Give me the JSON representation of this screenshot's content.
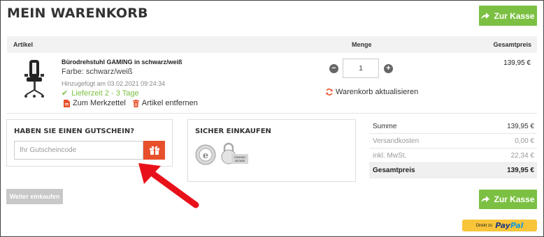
{
  "page": {
    "title": "MEIN WARENKORB"
  },
  "checkout_button_label": "Zur Kasse",
  "table": {
    "col_article": "Artikel",
    "col_quantity": "Menge",
    "col_total": "Gesamtpreis"
  },
  "item": {
    "name": "Bürodrehstuhl GAMING in schwarz/weiß",
    "color": "Farbe: schwarz/weiß",
    "added": "Hinzugefügt am 03.02.2021 09:24:34",
    "delivery": "Lieferzeit 2 - 3 Tage",
    "wishlist_label": "Zum Merkzettel",
    "remove_label": "Artikel entfernen",
    "quantity": "1",
    "update_label": "Warenkorb aktualisieren",
    "price": "139,95 €"
  },
  "voucher": {
    "title": "HABEN SIE EINEN GUTSCHEIN?",
    "placeholder": "Ihr Gutscheincode"
  },
  "secure": {
    "title": "SICHER EINKAUFEN",
    "seal_label": "COMODO SECURE"
  },
  "summary": {
    "rows": [
      {
        "label": "Summe",
        "value": "139,95 €"
      },
      {
        "label": "Versandkosten",
        "value": "0,00 €"
      },
      {
        "label": "inkl. MwSt.",
        "value": "22,34 €"
      },
      {
        "label": "Gesamtpreis",
        "value": "139,95 €"
      }
    ]
  },
  "continue_label": "Weiter einkaufen",
  "paypal": {
    "prefix": "Direkt zu",
    "logo_a": "Pay",
    "logo_b": "Pal"
  },
  "colors": {
    "accent_green": "#7cc043",
    "accent_red": "#e8502c",
    "annotation_arrow": "#e8111a",
    "paypal_yellow": "#f8c43a"
  }
}
